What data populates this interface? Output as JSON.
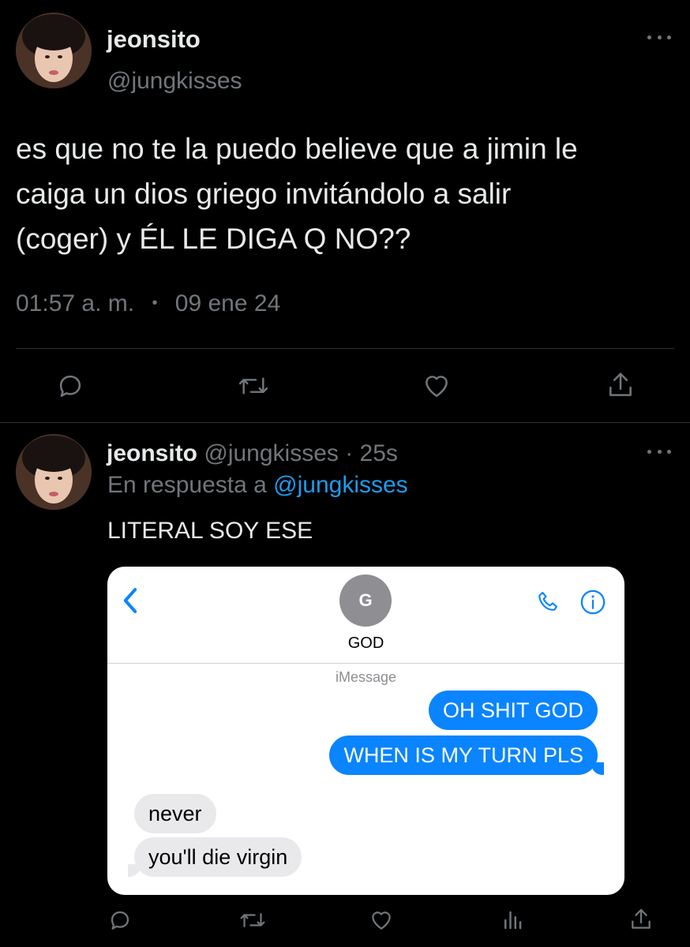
{
  "accent": "#1d9bf0",
  "main_tweet": {
    "display_name": "jeonsito",
    "handle": "@jungkisses",
    "text_line1": "es que no te la puedo believe que a jimin le",
    "text_line2": "caiga un dios griego invitándolo a salir",
    "text_line3": "(coger) y ÉL LE DIGA Q NO??",
    "time": "01:57 a. m.",
    "separator": "•",
    "date": "09 ene 24"
  },
  "reply_tweet": {
    "display_name": "jeonsito",
    "handle": "@jungkisses",
    "age": "· 25s",
    "replying_prefix": "En respuesta a",
    "replying_to": "@jungkisses",
    "text": "LITERAL SOY ESE"
  },
  "imessage": {
    "contact_initial": "G",
    "contact_name": "GOD",
    "service_label": "iMessage",
    "messages": [
      {
        "from": "me",
        "text": "OH SHIT GOD"
      },
      {
        "from": "me",
        "text": "WHEN IS MY TURN PLS"
      },
      {
        "from": "them",
        "text": "never"
      },
      {
        "from": "them",
        "text": "you'll die virgin"
      }
    ]
  },
  "icons": {
    "main_actions": [
      "reply-icon",
      "retweet-icon",
      "like-icon",
      "share-icon"
    ],
    "reply_actions": [
      "reply-icon",
      "retweet-icon",
      "like-icon",
      "views-icon",
      "share-icon"
    ]
  }
}
